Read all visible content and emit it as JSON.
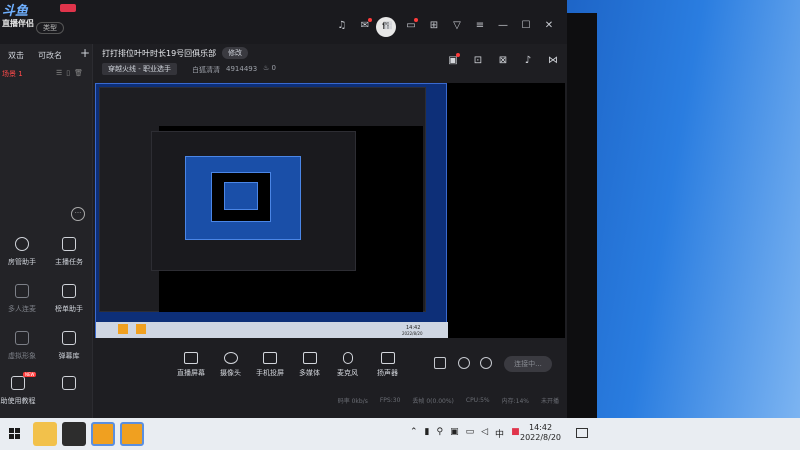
{
  "app": {
    "logo_text": "斗鱼",
    "logo_sub": "直播伴侣",
    "type_pill": "类型",
    "avatar_letter": "fi"
  },
  "titlebar_icons": [
    "headset-icon",
    "mail-icon",
    "grid-icon",
    "chat-icon",
    "gift-icon",
    "shirt-icon",
    "menu-icon",
    "minimize-icon",
    "maximize-icon",
    "close-icon"
  ],
  "left_panel": {
    "tabs": [
      "双击",
      "可改名"
    ],
    "plus": "+",
    "scene_label": "场景 1",
    "tools": [
      {
        "label": "房管助手",
        "icon": "user-icon",
        "dim": false
      },
      {
        "label": "主播任务",
        "icon": "task-icon",
        "dim": false
      },
      {
        "label": "多人连麦",
        "icon": "download-icon",
        "dim": true
      },
      {
        "label": "榜单助手",
        "icon": "rank-icon",
        "dim": false
      },
      {
        "label": "虚拟形象",
        "icon": "download-icon",
        "dim": true
      },
      {
        "label": "弹幕库",
        "icon": "danmu-icon",
        "dim": false
      },
      {
        "label": "助使用教程",
        "icon": "tutorial-icon",
        "dim": false,
        "tag": "NEW"
      },
      {
        "label": "",
        "icon": "download-icon",
        "dim": false
      }
    ]
  },
  "room": {
    "title": "打打排位叶叶时长19号回俱乐部",
    "edit_label": "修改",
    "category": "穿越火线 - 职业选手",
    "platform_label": "白狐清清",
    "room_number": "4914493",
    "heat": "0"
  },
  "header_icons": [
    "scene-icon",
    "unlock-icon",
    "lock-icon",
    "bell-icon",
    "share-icon"
  ],
  "bottom_tools": [
    {
      "label": "直播屏幕",
      "icon": "monitor-icon"
    },
    {
      "label": "摄像头",
      "icon": "camera-icon"
    },
    {
      "label": "手机投屏",
      "icon": "phone-icon"
    },
    {
      "label": "多媒体",
      "icon": "media-icon"
    },
    {
      "label": "麦克风",
      "icon": "mic-icon"
    },
    {
      "label": "扬声器",
      "icon": "speaker-icon"
    }
  ],
  "connect_label": "连接中...",
  "status": {
    "bitrate": "码率 0kb/s",
    "fps": "FPS:30",
    "drop": "丢帧 0(0.00%)",
    "cpu": "CPU:5%",
    "mem": "内存:14%",
    "net": "未开播"
  },
  "preview": {
    "time": "14:42",
    "date": "2022/8/20"
  },
  "taskbar": {
    "time": "14:42",
    "date": "2022/8/20",
    "ime": "中",
    "tray_icons": [
      "chevron-up-icon",
      "mic-tray-icon",
      "usb-icon",
      "network-icon",
      "battery-icon",
      "volume-icon",
      "ime-icon",
      "security-icon"
    ]
  },
  "colors": {
    "accent_red": "#ff3b3b",
    "app_bg": "#1e1e22",
    "desktop_blue": "#1656b8"
  }
}
